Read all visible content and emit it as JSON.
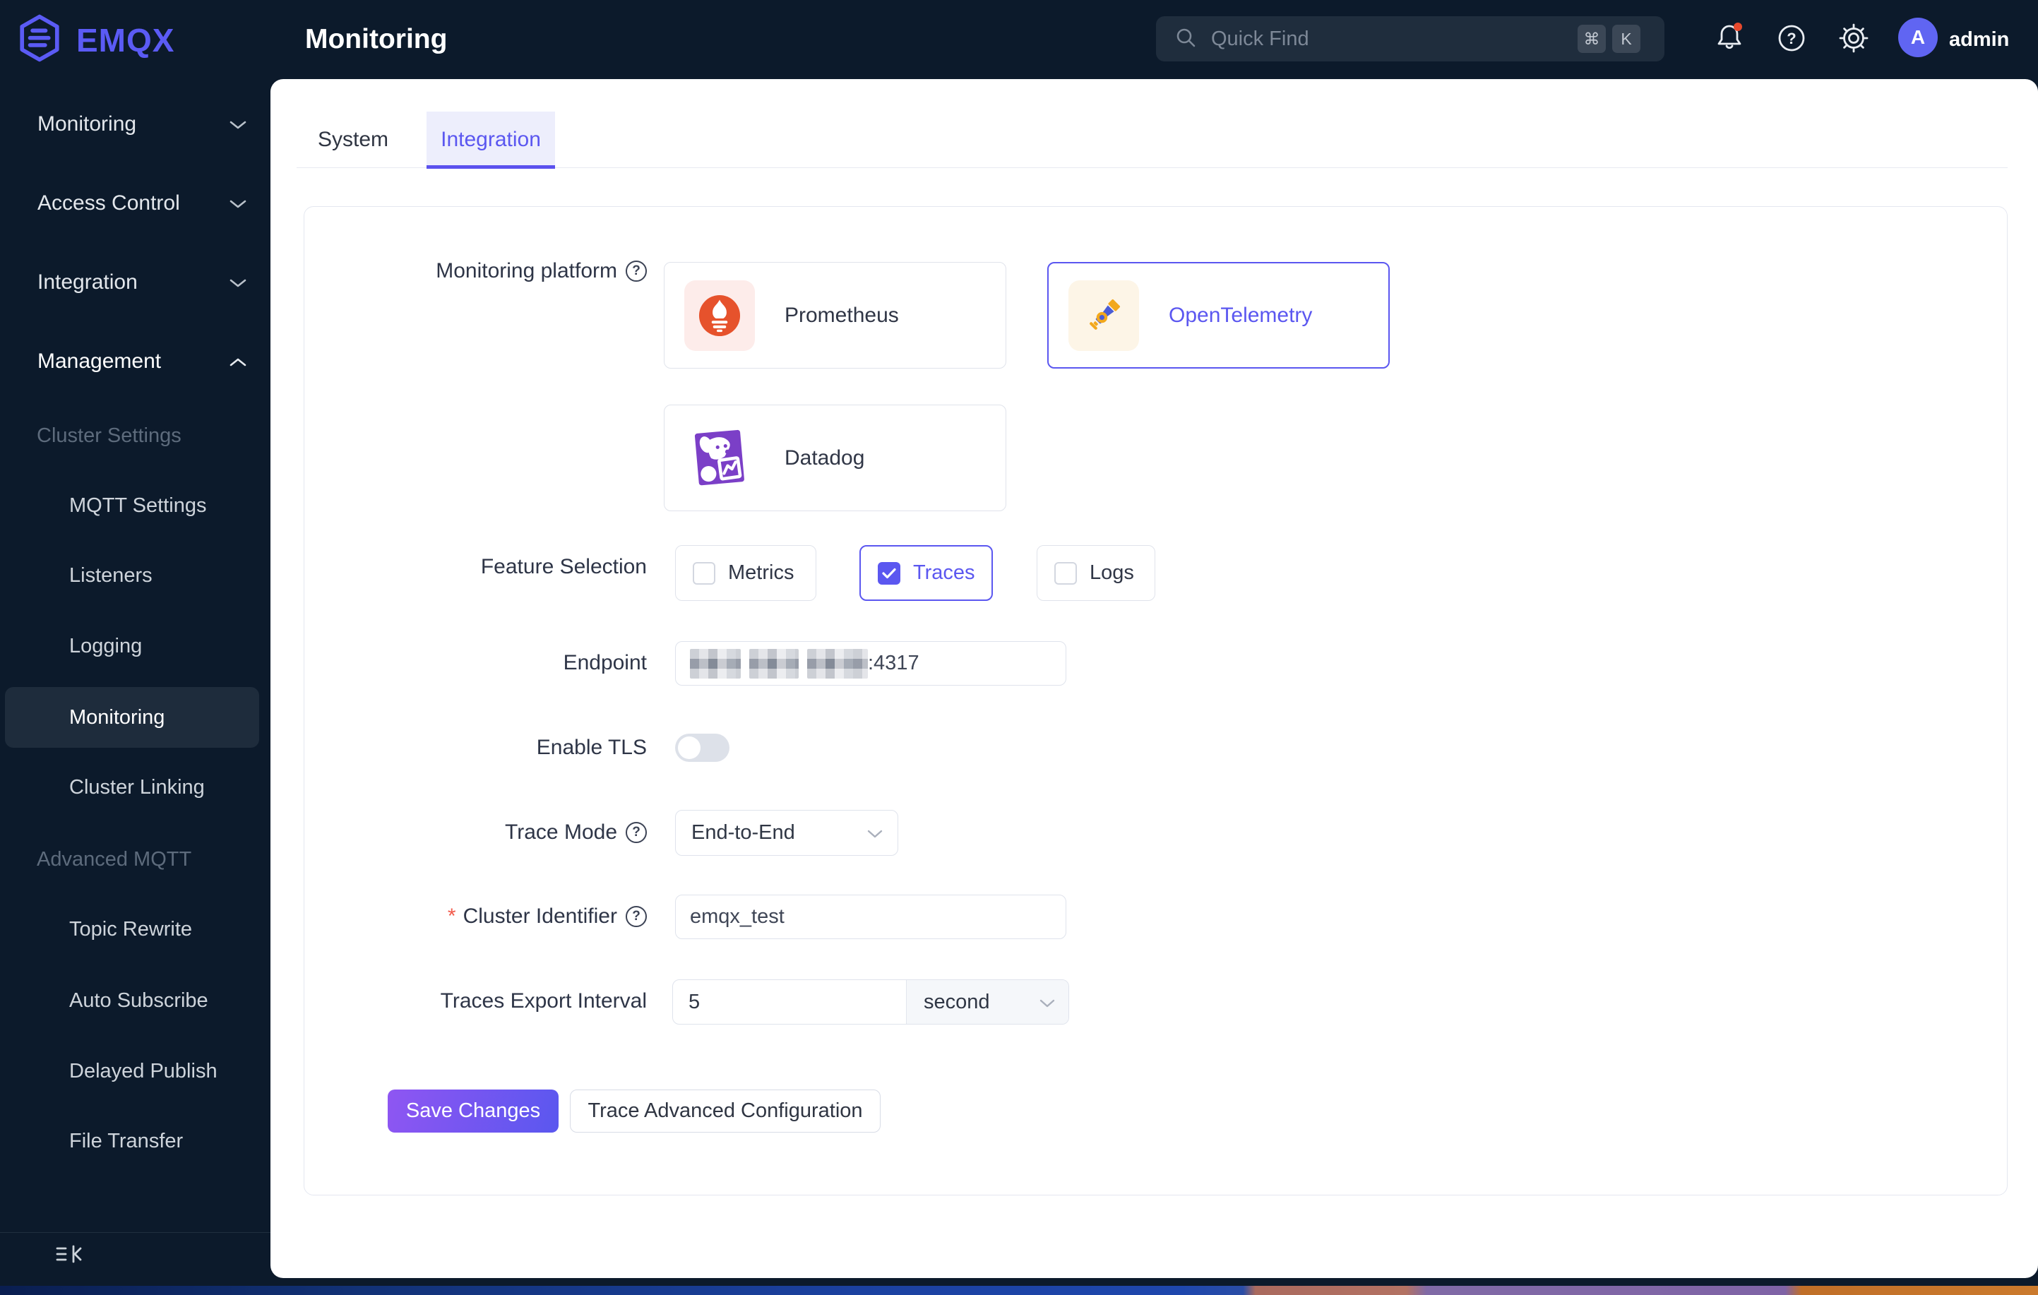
{
  "colors": {
    "accent": "#5b57f0",
    "dark_bg": "#0c1a2b",
    "notify_dot": "#e6492d"
  },
  "brand": {
    "name": "EMQX"
  },
  "header": {
    "title": "Monitoring",
    "search": {
      "placeholder": "Quick Find",
      "kbd_cmd": "⌘",
      "kbd_k": "K"
    },
    "user": {
      "initial": "A",
      "name": "admin"
    }
  },
  "sidebar": {
    "top_items": [
      {
        "label": "Monitoring"
      },
      {
        "label": "Access Control"
      },
      {
        "label": "Integration"
      },
      {
        "label": "Management"
      }
    ],
    "section_cluster": "Cluster Settings",
    "cluster_items": [
      {
        "label": "MQTT Settings"
      },
      {
        "label": "Listeners"
      },
      {
        "label": "Logging"
      },
      {
        "label": "Monitoring"
      },
      {
        "label": "Cluster Linking"
      }
    ],
    "section_advanced": "Advanced MQTT",
    "advanced_items": [
      {
        "label": "Topic Rewrite"
      },
      {
        "label": "Auto Subscribe"
      },
      {
        "label": "Delayed Publish"
      },
      {
        "label": "File Transfer"
      }
    ]
  },
  "tabs": {
    "system": "System",
    "integration": "Integration"
  },
  "form": {
    "platform_label": "Monitoring platform",
    "platforms": [
      {
        "name": "Prometheus",
        "selected": false
      },
      {
        "name": "OpenTelemetry",
        "selected": true
      },
      {
        "name": "Datadog",
        "selected": false
      }
    ],
    "feature_label": "Feature Selection",
    "features": [
      {
        "label": "Metrics",
        "checked": false
      },
      {
        "label": "Traces",
        "checked": true
      },
      {
        "label": "Logs",
        "checked": false
      }
    ],
    "endpoint_label": "Endpoint",
    "endpoint_visible_port": ":4317",
    "tls_label": "Enable TLS",
    "tls_on": false,
    "trace_mode_label": "Trace Mode",
    "trace_mode_value": "End-to-End",
    "cluster_id_label": "Cluster Identifier",
    "cluster_id_required_mark": "*",
    "cluster_id_value": "emqx_test",
    "interval_label": "Traces Export Interval",
    "interval_value": "5",
    "interval_unit": "second",
    "save_button": "Save Changes",
    "advanced_button": "Trace Advanced Configuration"
  }
}
